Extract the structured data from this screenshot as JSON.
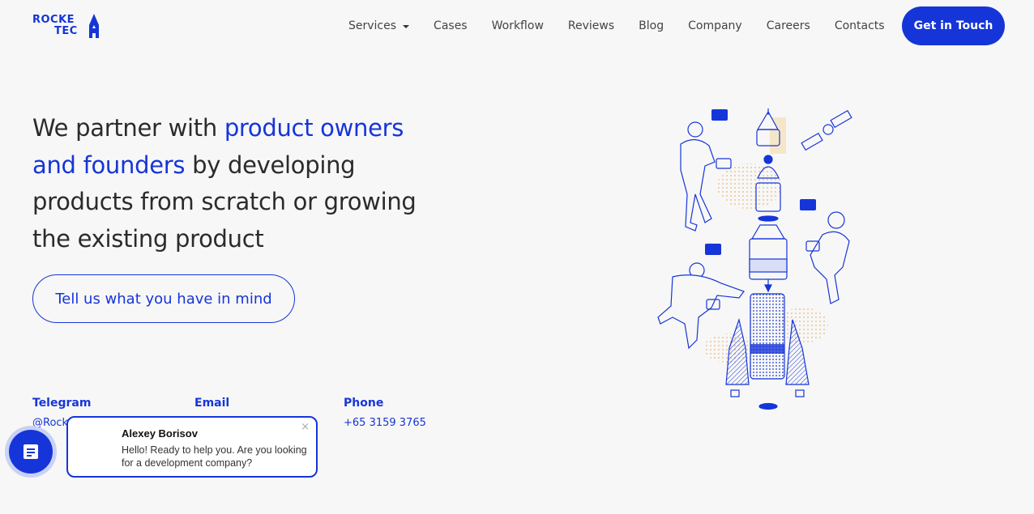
{
  "header": {
    "logo": {
      "line1": "ROCKE",
      "line2": "TEC"
    },
    "nav": [
      {
        "label": "Services",
        "has_dropdown": true
      },
      {
        "label": "Cases"
      },
      {
        "label": "Workflow"
      },
      {
        "label": "Reviews"
      },
      {
        "label": "Blog"
      },
      {
        "label": "Company"
      },
      {
        "label": "Careers"
      },
      {
        "label": "Contacts"
      }
    ],
    "cta_label": "Get in Touch"
  },
  "hero": {
    "text_before": "We partner with ",
    "text_accent": "product owners and founders",
    "text_after": " by developing products from scratch or growing the existing product",
    "button_label": "Tell us what you have in mind"
  },
  "contacts": {
    "telegram": {
      "label": "Telegram",
      "value": "@Rock"
    },
    "email": {
      "label": "Email"
    },
    "phone": {
      "label": "Phone",
      "value": "+65 3159 3765"
    }
  },
  "chat": {
    "name": "Alexey Borisov",
    "message": "Hello! Ready to help you. Are you looking for a development company?",
    "close_symbol": "×"
  },
  "colors": {
    "accent": "#1635d8",
    "background": "#f7f7f7",
    "text": "#2b2b2b"
  }
}
